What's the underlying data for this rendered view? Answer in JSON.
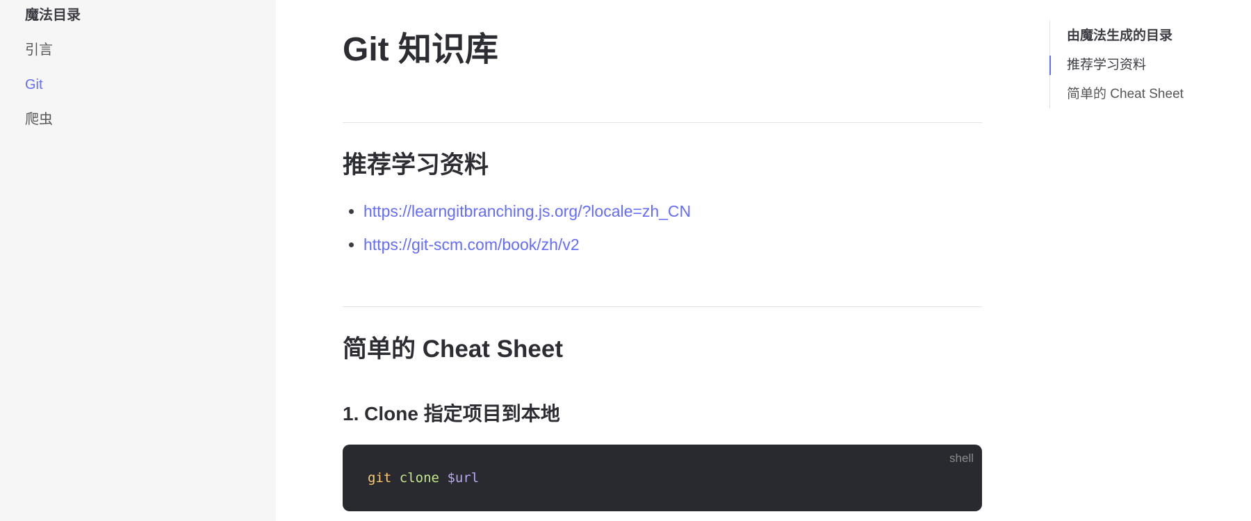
{
  "sidebar": {
    "title": "魔法目录",
    "items": [
      {
        "label": "引言",
        "active": false
      },
      {
        "label": "Git",
        "active": true
      },
      {
        "label": "爬虫",
        "active": false
      }
    ]
  },
  "main": {
    "title": "Git 知识库",
    "sections": {
      "resources": {
        "heading": "推荐学习资料",
        "links": [
          "https://learngitbranching.js.org/?locale=zh_CN",
          "https://git-scm.com/book/zh/v2"
        ]
      },
      "cheatsheet": {
        "heading": "简单的 Cheat Sheet",
        "subheading": "1. Clone 指定项目到本地",
        "code": {
          "lang": "shell",
          "tokens": {
            "cmd": "git",
            "sub": "clone",
            "var": "$url"
          }
        }
      }
    }
  },
  "outline": {
    "title": "由魔法生成的目录",
    "items": [
      {
        "label": "推荐学习资料",
        "active": true
      },
      {
        "label": "简单的 Cheat Sheet",
        "active": false
      }
    ]
  },
  "colors": {
    "accent": "#646cff",
    "sidebar_bg": "#f6f6f7",
    "code_bg": "#292a2f"
  }
}
